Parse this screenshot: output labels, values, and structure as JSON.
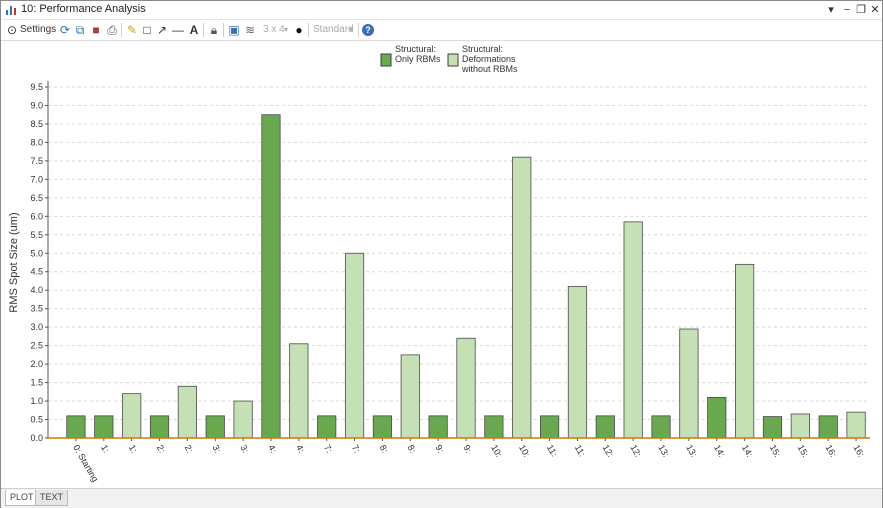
{
  "window": {
    "title": "10: Performance Analysis",
    "controls": [
      "▾",
      "−",
      "❐",
      "✕"
    ]
  },
  "toolbar": {
    "settings_label": "Settings",
    "layout_label": "3 x 4",
    "style_label": "Standard"
  },
  "tabs": [
    {
      "label": "PLOT",
      "active": true
    },
    {
      "label": "TEXT",
      "active": false
    }
  ],
  "colors": {
    "series_dark": "#6aa84f",
    "series_light": "#c5e0b4",
    "axis_line": "#cc7a00",
    "grid": "#d8d8d8"
  },
  "chart_data": {
    "type": "bar",
    "ylabel": "RMS Spot Size (um)",
    "xlabel": "",
    "ylim": [
      0,
      9.5
    ],
    "ytick_step": 0.5,
    "yticks": [
      "0.0",
      "0.5",
      "1.0",
      "1.5",
      "2.0",
      "2.5",
      "3.0",
      "3.5",
      "4.0",
      "4.5",
      "5.0",
      "5.5",
      "6.0",
      "6.5",
      "7.0",
      "7.5",
      "8.0",
      "8.5",
      "9.0",
      "9.5"
    ],
    "grid": "horizontal dashed",
    "legend_position": "top-center",
    "series": [
      {
        "name": "Structural: Only RBMs",
        "color": "#6aa84f"
      },
      {
        "name": "Structural: Deformations without RBMs",
        "color": "#c5e0b4"
      }
    ],
    "legend": [
      {
        "lines": [
          "Structural:",
          "Only RBMs"
        ],
        "color": "#6aa84f"
      },
      {
        "lines": [
          "Structural:",
          "Deformations",
          "without RBMs"
        ],
        "color": "#c5e0b4"
      }
    ],
    "bars": [
      {
        "label": "0: Starting",
        "value": 0.6,
        "series": 0
      },
      {
        "label": "1:",
        "value": 0.6,
        "series": 0
      },
      {
        "label": "1:",
        "value": 1.2,
        "series": 1
      },
      {
        "label": "2:",
        "value": 0.6,
        "series": 0
      },
      {
        "label": "2:",
        "value": 1.4,
        "series": 1
      },
      {
        "label": "3:",
        "value": 0.6,
        "series": 0
      },
      {
        "label": "3:",
        "value": 1.0,
        "series": 1
      },
      {
        "label": "4:",
        "value": 8.75,
        "series": 0
      },
      {
        "label": "4:",
        "value": 2.55,
        "series": 1
      },
      {
        "label": "7:",
        "value": 0.6,
        "series": 0
      },
      {
        "label": "7:",
        "value": 5.0,
        "series": 1
      },
      {
        "label": "8:",
        "value": 0.6,
        "series": 0
      },
      {
        "label": "8:",
        "value": 2.25,
        "series": 1
      },
      {
        "label": "9:",
        "value": 0.6,
        "series": 0
      },
      {
        "label": "9:",
        "value": 2.7,
        "series": 1
      },
      {
        "label": "10:",
        "value": 0.6,
        "series": 0
      },
      {
        "label": "10:",
        "value": 7.6,
        "series": 1
      },
      {
        "label": "11:",
        "value": 0.6,
        "series": 0
      },
      {
        "label": "11:",
        "value": 4.1,
        "series": 1
      },
      {
        "label": "12:",
        "value": 0.6,
        "series": 0
      },
      {
        "label": "12:",
        "value": 5.85,
        "series": 1
      },
      {
        "label": "13:",
        "value": 0.6,
        "series": 0
      },
      {
        "label": "13:",
        "value": 2.95,
        "series": 1
      },
      {
        "label": "14:",
        "value": 1.1,
        "series": 0
      },
      {
        "label": "14:",
        "value": 4.7,
        "series": 1
      },
      {
        "label": "15:",
        "value": 0.58,
        "series": 0
      },
      {
        "label": "15:",
        "value": 0.65,
        "series": 1
      },
      {
        "label": "16:",
        "value": 0.6,
        "series": 0
      },
      {
        "label": "16:",
        "value": 0.7,
        "series": 1
      }
    ]
  }
}
